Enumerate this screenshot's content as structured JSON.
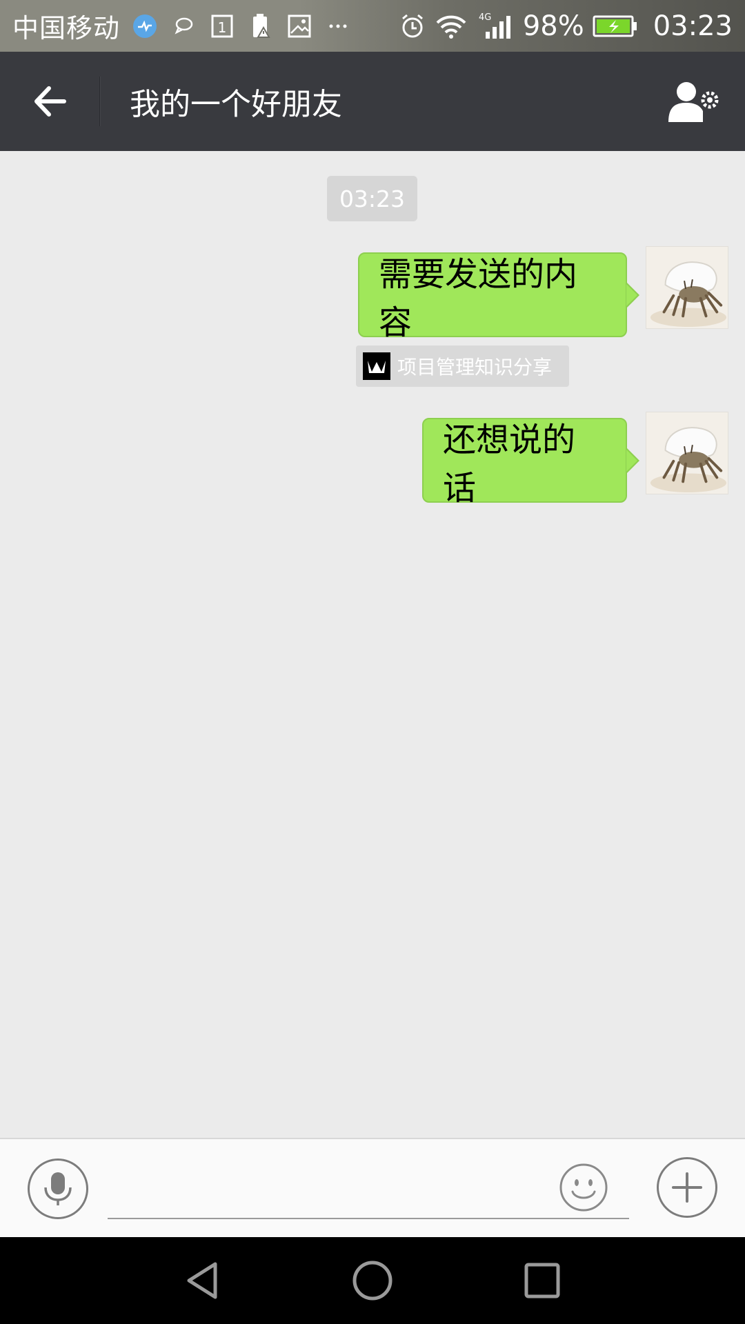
{
  "status_bar": {
    "carrier": "中国移动",
    "network": "4G",
    "battery_percent": "98%",
    "time": "03:23",
    "icons": [
      "health-icon",
      "chat-bubble-icon",
      "sim-1-icon",
      "battery-warning-icon",
      "image-icon",
      "more-dots-icon",
      "alarm-icon",
      "wifi-icon",
      "signal-icon",
      "battery-charging-icon"
    ]
  },
  "header": {
    "title": "我的一个好朋友",
    "back_icon": "arrow-left-icon",
    "profile_icon": "user-settings-icon"
  },
  "chat": {
    "timestamp": "03:23",
    "messages": [
      {
        "sender": "me",
        "text": "需要发送的内容",
        "source": "项目管理知识分享"
      },
      {
        "sender": "me",
        "text": "还想说的话"
      }
    ]
  },
  "input_bar": {
    "text_value": "",
    "voice_icon": "microphone-icon",
    "emoji_icon": "smiley-icon",
    "more_icon": "plus-icon"
  },
  "nav_bar": {
    "icons": [
      "nav-back-icon",
      "nav-home-icon",
      "nav-recents-icon"
    ]
  },
  "colors": {
    "header_bg": "#393a3f",
    "chat_bg": "#ebebeb",
    "bubble_green": "#a0e75a",
    "bubble_border": "#8dcf4f",
    "battery_green": "#7bd62b"
  }
}
